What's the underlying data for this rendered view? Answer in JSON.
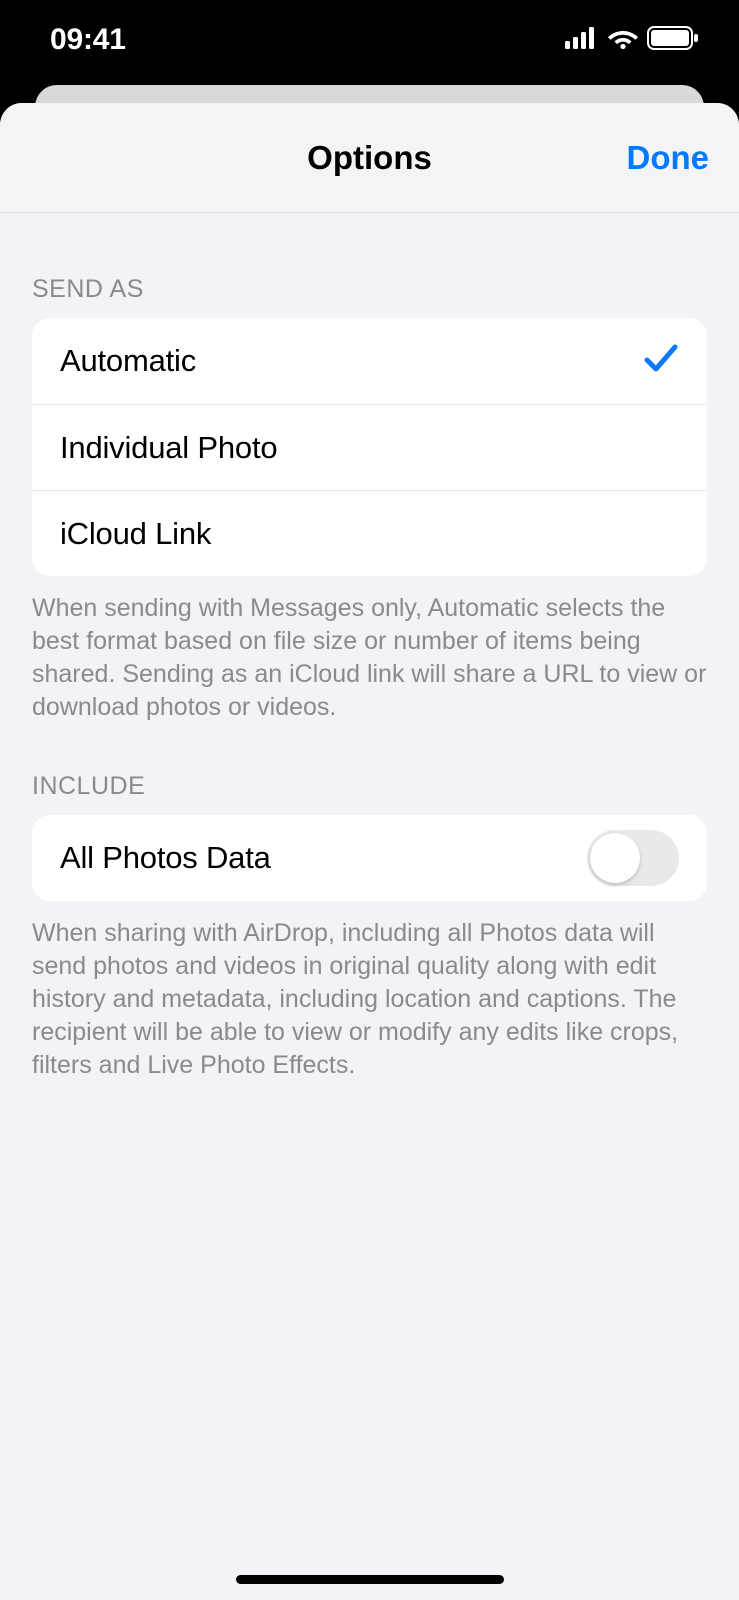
{
  "status": {
    "time": "09:41"
  },
  "header": {
    "title": "Options",
    "done": "Done"
  },
  "sections": {
    "send_as": {
      "header": "SEND AS",
      "options": [
        {
          "label": "Automatic",
          "selected": true
        },
        {
          "label": "Individual Photo",
          "selected": false
        },
        {
          "label": "iCloud Link",
          "selected": false
        }
      ],
      "footer": "When sending with Messages only, Automatic selects the best format based on file size or number of items being shared. Sending as an iCloud link will share a URL to view or download photos or videos."
    },
    "include": {
      "header": "INCLUDE",
      "all_photos_data": {
        "label": "All Photos Data",
        "enabled": false
      },
      "footer": "When sharing with AirDrop, including all Photos data will send photos and videos in original quality along with edit history and metadata, including location and captions. The recipient will be able to view or modify any edits like crops, filters and Live Photo Effects."
    }
  }
}
